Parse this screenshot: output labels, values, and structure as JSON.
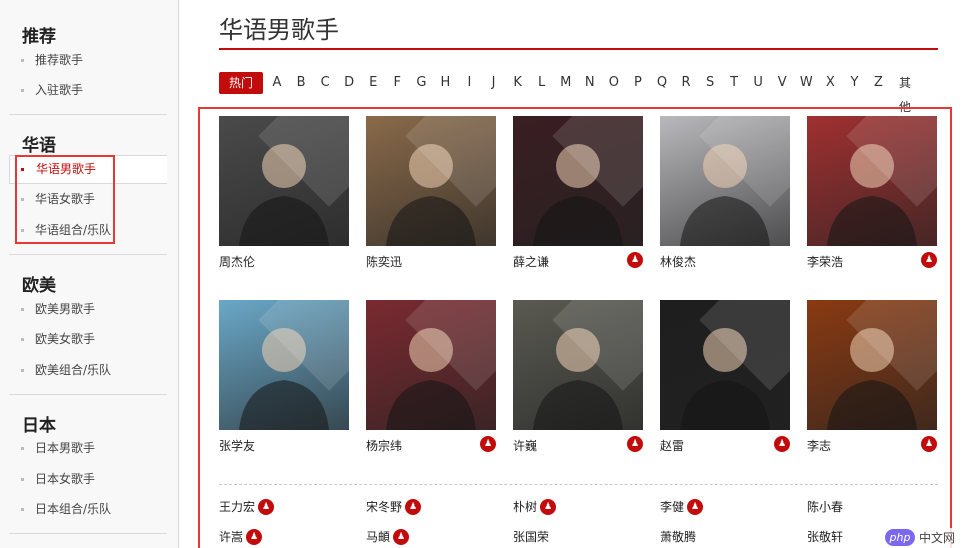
{
  "sidebar": {
    "groups": [
      {
        "title": "推荐",
        "items": [
          "推荐歌手",
          "入驻歌手"
        ]
      },
      {
        "title": "华语",
        "items": [
          "华语男歌手",
          "华语女歌手",
          "华语组合/乐队"
        ]
      },
      {
        "title": "欧美",
        "items": [
          "欧美男歌手",
          "欧美女歌手",
          "欧美组合/乐队"
        ]
      },
      {
        "title": "日本",
        "items": [
          "日本男歌手",
          "日本女歌手",
          "日本组合/乐队"
        ]
      }
    ],
    "active_item": "华语男歌手"
  },
  "main": {
    "title": "华语男歌手",
    "alpha_filter": {
      "hot": "热门",
      "letters": [
        "A",
        "B",
        "C",
        "D",
        "E",
        "F",
        "G",
        "H",
        "I",
        "J",
        "K",
        "L",
        "M",
        "N",
        "O",
        "P",
        "Q",
        "R",
        "S",
        "T",
        "U",
        "V",
        "W",
        "X",
        "Y",
        "Z"
      ],
      "other": "其他",
      "selected": "热门"
    },
    "photo_artists": [
      {
        "name": "周杰伦",
        "badge": false,
        "bg": "#4a4a4a"
      },
      {
        "name": "陈奕迅",
        "badge": false,
        "bg": "#8a6a4a"
      },
      {
        "name": "薛之谦",
        "badge": true,
        "bg": "#3a1e22"
      },
      {
        "name": "林俊杰",
        "badge": false,
        "bg": "#b9b9bd"
      },
      {
        "name": "李荣浩",
        "badge": true,
        "bg": "#a03030"
      },
      {
        "name": "张学友",
        "badge": false,
        "bg": "#6aa8c8"
      },
      {
        "name": "杨宗纬",
        "badge": true,
        "bg": "#7a2a30"
      },
      {
        "name": "许巍",
        "badge": true,
        "bg": "#5a5a52"
      },
      {
        "name": "赵雷",
        "badge": true,
        "bg": "#1e1e1e"
      },
      {
        "name": "李志",
        "badge": true,
        "bg": "#8a3a12"
      }
    ],
    "text_artists": [
      {
        "name": "王力宏",
        "badge": true
      },
      {
        "name": "宋冬野",
        "badge": true
      },
      {
        "name": "朴树",
        "badge": true
      },
      {
        "name": "李健",
        "badge": true
      },
      {
        "name": "陈小春",
        "badge": false
      },
      {
        "name": "许嵩",
        "badge": true
      },
      {
        "name": "马頔",
        "badge": true
      },
      {
        "name": "张国荣",
        "badge": false
      },
      {
        "name": "萧敬腾",
        "badge": false
      },
      {
        "name": "张敬轩",
        "badge": false
      }
    ],
    "badge_icon": "user-badge-icon"
  },
  "watermark": {
    "logo": "php",
    "text": "中文网"
  },
  "colors": {
    "accent": "#c20c0c",
    "highlight": "#e53935",
    "sidebar_bg": "#f8f8f8"
  }
}
